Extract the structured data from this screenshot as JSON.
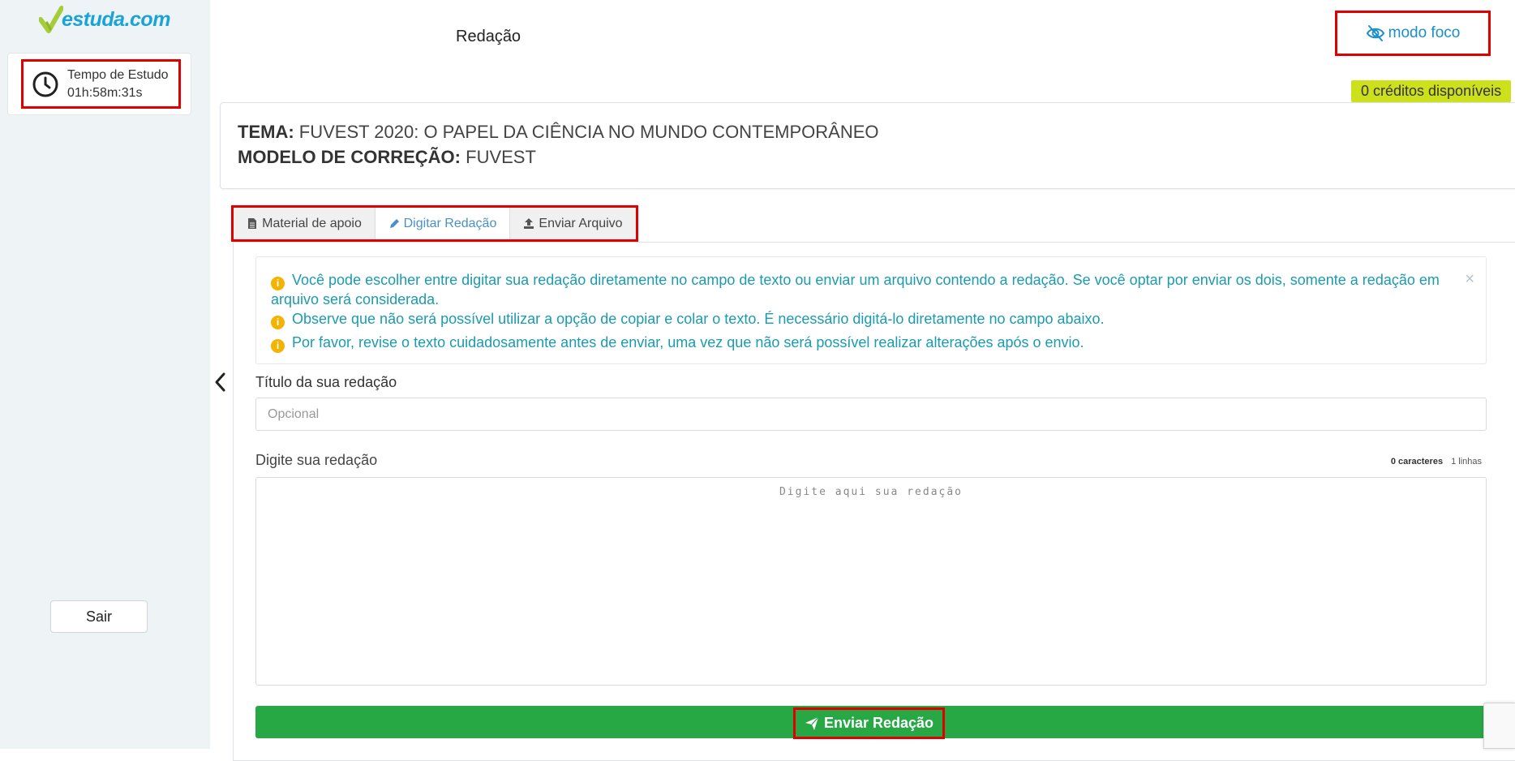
{
  "brand": {
    "name": "estuda.com",
    "color": "#1aa3d6",
    "check_color": "#a4cd39"
  },
  "sidebar": {
    "study_time_label": "Tempo de Estudo",
    "study_time_value": "01h:58m:31s",
    "logout_label": "Sair"
  },
  "header": {
    "title": "Redação",
    "focus_mode_label": "modo foco",
    "credits_label": "0 créditos disponíveis"
  },
  "theme": {
    "topic_key": "TEMA:",
    "topic_value": "FUVEST 2020: O PAPEL DA CIÊNCIA NO MUNDO CONTEMPORÂNEO",
    "model_key": "MODELO DE CORREÇÃO:",
    "model_value": "FUVEST"
  },
  "tabs": [
    {
      "label": "Material de apoio",
      "icon": "file-icon",
      "active": false
    },
    {
      "label": "Digitar Redação",
      "icon": "pencil-icon",
      "active": true
    },
    {
      "label": "Enviar Arquivo",
      "icon": "upload-icon",
      "active": false
    }
  ],
  "alert": {
    "lines": [
      "Você pode escolher entre digitar sua redação diretamente no campo de texto ou enviar um arquivo contendo a redação. Se você optar por enviar os dois, somente a redação em arquivo será considerada.",
      "Observe que não será possível utilizar a opção de copiar e colar o texto. É necessário digitá-lo diretamente no campo abaixo.",
      "Por favor, revise o texto cuidadosamente antes de enviar, uma vez que não será possível realizar alterações após o envio."
    ],
    "close": "×"
  },
  "form": {
    "title_label": "Título da sua redação",
    "title_placeholder": "Opcional",
    "title_value": "",
    "essay_label": "Digite sua redação",
    "essay_placeholder": "Digite aqui sua redação",
    "char_count": "0 caracteres",
    "line_count": "1 linhas",
    "submit_label": "Enviar Redação"
  },
  "colors": {
    "accent": "#1b8fc9",
    "submit": "#28a745",
    "credits_badge": "#cde01c",
    "alert_text": "#1a9bb0",
    "highlight": "#e00000"
  }
}
